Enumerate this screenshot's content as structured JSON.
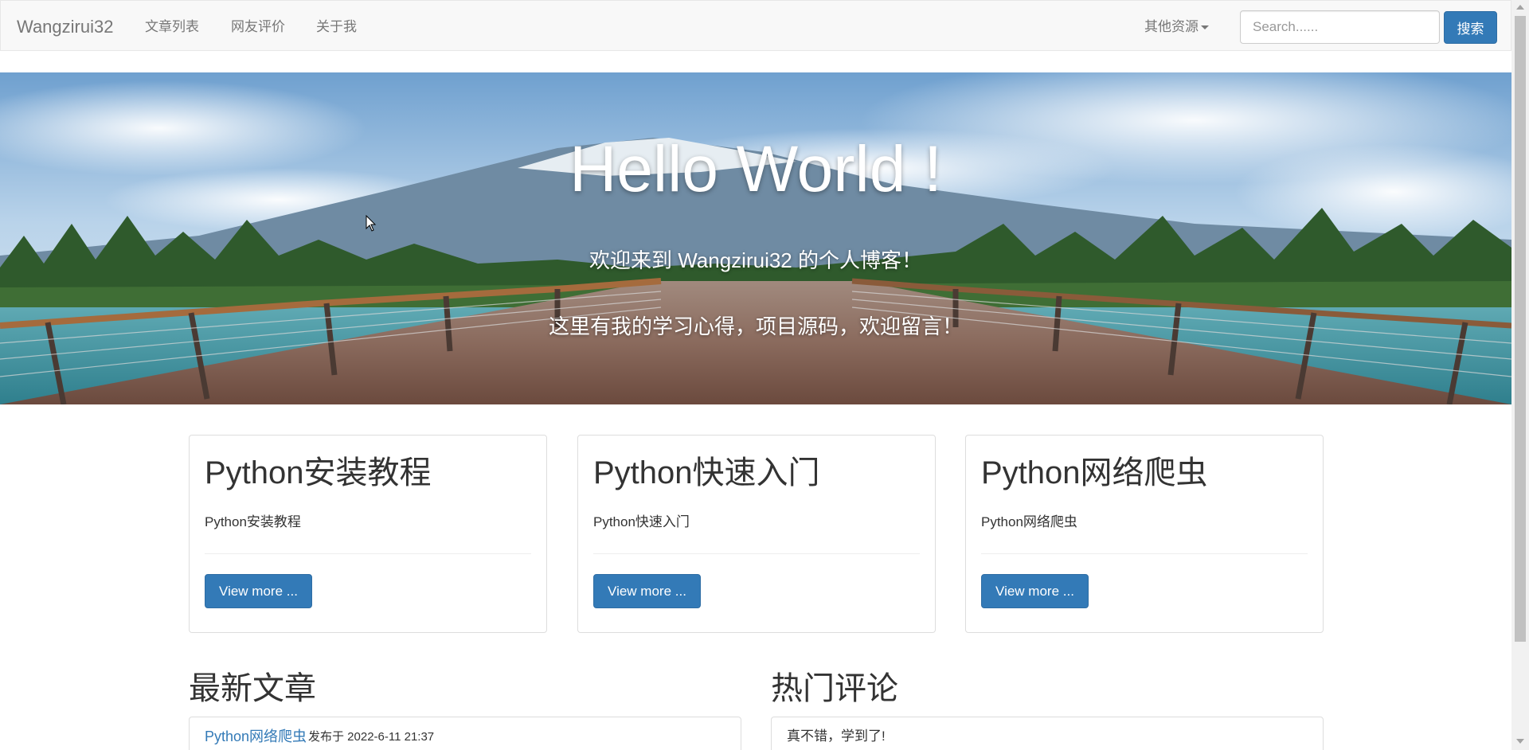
{
  "navbar": {
    "brand": "Wangzirui32",
    "links": [
      "文章列表",
      "网友评价",
      "关于我"
    ],
    "dropdown_label": "其他资源",
    "search_placeholder": "Search......",
    "search_button": "搜索"
  },
  "hero": {
    "title": "Hello World !",
    "subtitle_1": "欢迎来到 Wangzirui32 的个人博客！",
    "subtitle_2": "这里有我的学习心得，项目源码，欢迎留言！"
  },
  "cards": [
    {
      "title": "Python安装教程",
      "description": "Python安装教程",
      "button": "View more ..."
    },
    {
      "title": "Python快速入门",
      "description": "Python快速入门",
      "button": "View more ..."
    },
    {
      "title": "Python网络爬虫",
      "description": "Python网络爬虫",
      "button": "View more ..."
    }
  ],
  "latest": {
    "heading": "最新文章",
    "item_title": "Python网络爬虫",
    "item_meta": "发布于 2022-6-11 21:37"
  },
  "comments": {
    "heading": "热门评论",
    "item_text": "真不错，学到了!"
  },
  "colors": {
    "primary": "#337ab7",
    "navbar_bg": "#f8f8f8",
    "text": "#333333",
    "muted": "#777777"
  }
}
